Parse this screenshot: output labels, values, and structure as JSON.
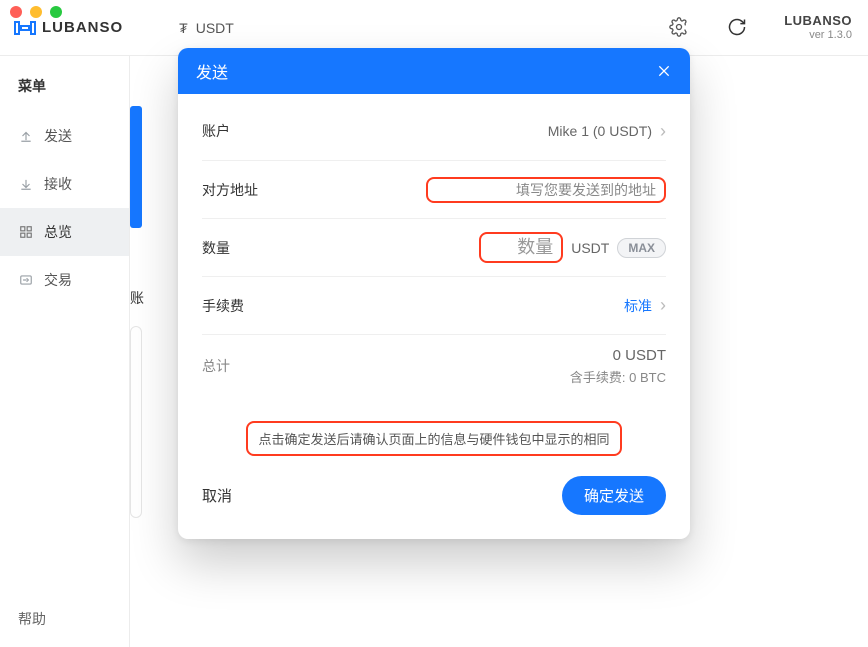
{
  "brand": {
    "name": "LUBANSO"
  },
  "currency": {
    "symbol": "₮",
    "code": "USDT"
  },
  "version": {
    "name": "LUBANSO",
    "ver": "ver 1.3.0"
  },
  "sidebar": {
    "title": "菜单",
    "items": [
      {
        "label": "发送"
      },
      {
        "label": "接收"
      },
      {
        "label": "总览"
      },
      {
        "label": "交易"
      }
    ],
    "help": "帮助"
  },
  "main": {
    "section_label": "账"
  },
  "modal": {
    "title": "发送",
    "account": {
      "label": "账户",
      "value": "Mike 1 (0 USDT)"
    },
    "address": {
      "label": "对方地址",
      "placeholder": "填写您要发送到的地址"
    },
    "amount": {
      "label": "数量",
      "placeholder": "数量",
      "unit": "USDT",
      "max": "MAX"
    },
    "fee": {
      "label": "手续费",
      "value": "标准"
    },
    "total": {
      "label": "总计",
      "value": "0 USDT",
      "fee_line": "含手续费: 0 BTC"
    },
    "notice": "点击确定发送后请确认页面上的信息与硬件钱包中显示的相同",
    "cancel": "取消",
    "confirm": "确定发送"
  }
}
